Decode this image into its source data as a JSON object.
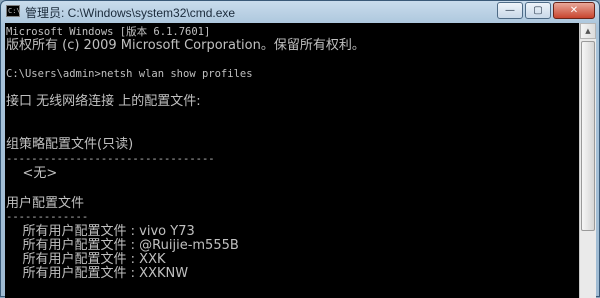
{
  "window": {
    "title": "管理员: C:\\Windows\\system32\\cmd.exe",
    "icon_text": "C:\\",
    "controls": {
      "minimize": "—",
      "maximize": "▢",
      "close": "✕"
    }
  },
  "console": {
    "lines": [
      "Microsoft Windows [版本 6.1.7601]",
      "版权所有 (c) 2009 Microsoft Corporation。保留所有权利。",
      "",
      "C:\\Users\\admin>netsh wlan show profiles",
      "",
      "接口 无线网络连接 上的配置文件:",
      "",
      "",
      "组策略配置文件(只读)",
      "---------------------------------",
      "    <无>",
      "",
      "用户配置文件",
      "-------------",
      "    所有用户配置文件 : vivo Y73",
      "    所有用户配置文件 : @Ruijie-m555B",
      "    所有用户配置文件 : XXK",
      "    所有用户配置文件 : XXKNW"
    ]
  },
  "scrollbar": {
    "up_arrow": "▲",
    "down_arrow": "▼"
  }
}
